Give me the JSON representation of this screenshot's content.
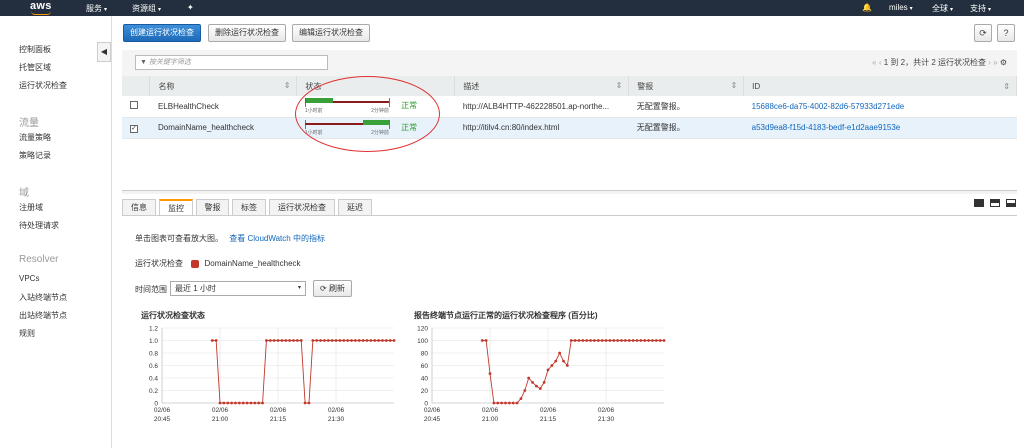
{
  "topnav": {
    "logo": "aws",
    "services": "服务",
    "resource_groups": "资源组",
    "user": "miles",
    "region": "全球",
    "support": "支持"
  },
  "sidebar": {
    "items_top": [
      "控制面板",
      "托管区域",
      "运行状况检查"
    ],
    "section_traffic": "流量",
    "items_traffic": [
      "流量策略",
      "策略记录"
    ],
    "section_domain": "域",
    "items_domain": [
      "注册域",
      "待处理请求"
    ],
    "section_resolver": "Resolver",
    "items_resolver": [
      "VPCs",
      "入站终端节点",
      "出站终端节点",
      "规则"
    ]
  },
  "toolbar": {
    "create": "创建运行状况检查",
    "delete": "删除运行状况检查",
    "edit": "编辑运行状况检查"
  },
  "filter": {
    "placeholder": "按关键字筛选",
    "pager": "1 到 2，共计 2 运行状况检查"
  },
  "table": {
    "headers": [
      "名称",
      "状态",
      "描述",
      "警报",
      "ID"
    ],
    "rows": [
      {
        "name": "ELBHealthCheck",
        "status": "正常",
        "bar_left": "1小时前",
        "bar_right": "2分钟前",
        "desc": "http://ALB4HTTP-462228501.ap-northe...",
        "alarm": "无配置警报。",
        "id": "15688ce6-da75-4002-82d6-57933d271ede"
      },
      {
        "name": "DomainName_healthcheck",
        "status": "正常",
        "bar_left": "1小时前",
        "bar_right": "2分钟前",
        "desc": "http://itilv4.cn:80/index.html",
        "alarm": "无配置警报。",
        "id": "a53d9ea8-f15d-4183-bedf-e1d2aae9153e"
      }
    ]
  },
  "tabs": [
    "信息",
    "监控",
    "警报",
    "标签",
    "运行状况检查",
    "延迟"
  ],
  "monitor": {
    "hint": "单击图表可查看放大图。",
    "hint_link": "查看 CloudWatch 中的指标",
    "check_label": "运行状况检查",
    "check_name": "DomainName_healthcheck",
    "time_label": "时间范围",
    "time_value": "最近 1 小时",
    "refresh": "刷新"
  },
  "colors": {
    "series": "#c0392b",
    "primary": "#1d6ab8",
    "ok": "#2a9d2a"
  },
  "chart_data": [
    {
      "type": "line",
      "title": "运行状况检查状态",
      "x_ticks": [
        "02/06\n20:45",
        "02/06\n21:00",
        "02/06\n21:15",
        "02/06\n21:30"
      ],
      "y_ticks": [
        "0",
        "0.2",
        "0.4",
        "0.6",
        "0.8",
        "1.0",
        "1.2"
      ],
      "ylim": [
        0,
        1.2
      ],
      "points_x_min": [
        13,
        14,
        15,
        16,
        17,
        18,
        19,
        20,
        21,
        22,
        23,
        24,
        25,
        26,
        27,
        28,
        29,
        30,
        31,
        32,
        33,
        34,
        35,
        36,
        37,
        38,
        39,
        40,
        41,
        42,
        43,
        44,
        45,
        46,
        47,
        48,
        49,
        50,
        51,
        52,
        53,
        54,
        55,
        56,
        57,
        58,
        59,
        60
      ],
      "values": [
        1,
        1,
        0,
        0,
        0,
        0,
        0,
        0,
        0,
        0,
        0,
        0,
        0,
        0,
        1,
        1,
        1,
        1,
        1,
        1,
        1,
        1,
        1,
        1,
        0,
        0,
        1,
        1,
        1,
        1,
        1,
        1,
        1,
        1,
        1,
        1,
        1,
        1,
        1,
        1,
        1,
        1,
        1,
        1,
        1,
        1,
        1,
        1
      ]
    },
    {
      "type": "line",
      "title": "报告终端节点运行正常的运行状况检查程序 (百分比)",
      "x_ticks": [
        "02/06\n20:45",
        "02/06\n21:00",
        "02/06\n21:15",
        "02/06\n21:30"
      ],
      "y_ticks": [
        "0",
        "20",
        "40",
        "60",
        "80",
        "100",
        "120"
      ],
      "ylim": [
        0,
        120
      ],
      "points_x_min": [
        13,
        14,
        15,
        16,
        17,
        18,
        19,
        20,
        21,
        22,
        23,
        24,
        25,
        26,
        27,
        28,
        29,
        30,
        31,
        32,
        33,
        34,
        35,
        36,
        37,
        38,
        39,
        40,
        41,
        42,
        43,
        44,
        45,
        46,
        47,
        48,
        49,
        50,
        51,
        52,
        53,
        54,
        55,
        56,
        57,
        58,
        59,
        60
      ],
      "values": [
        100,
        100,
        47,
        0,
        0,
        0,
        0,
        0,
        0,
        0,
        7,
        20,
        40,
        33,
        27,
        23,
        33,
        53,
        60,
        67,
        80,
        67,
        60,
        100,
        100,
        100,
        100,
        100,
        100,
        100,
        100,
        100,
        100,
        100,
        100,
        100,
        100,
        100,
        100,
        100,
        100,
        100,
        100,
        100,
        100,
        100,
        100,
        100
      ]
    }
  ]
}
